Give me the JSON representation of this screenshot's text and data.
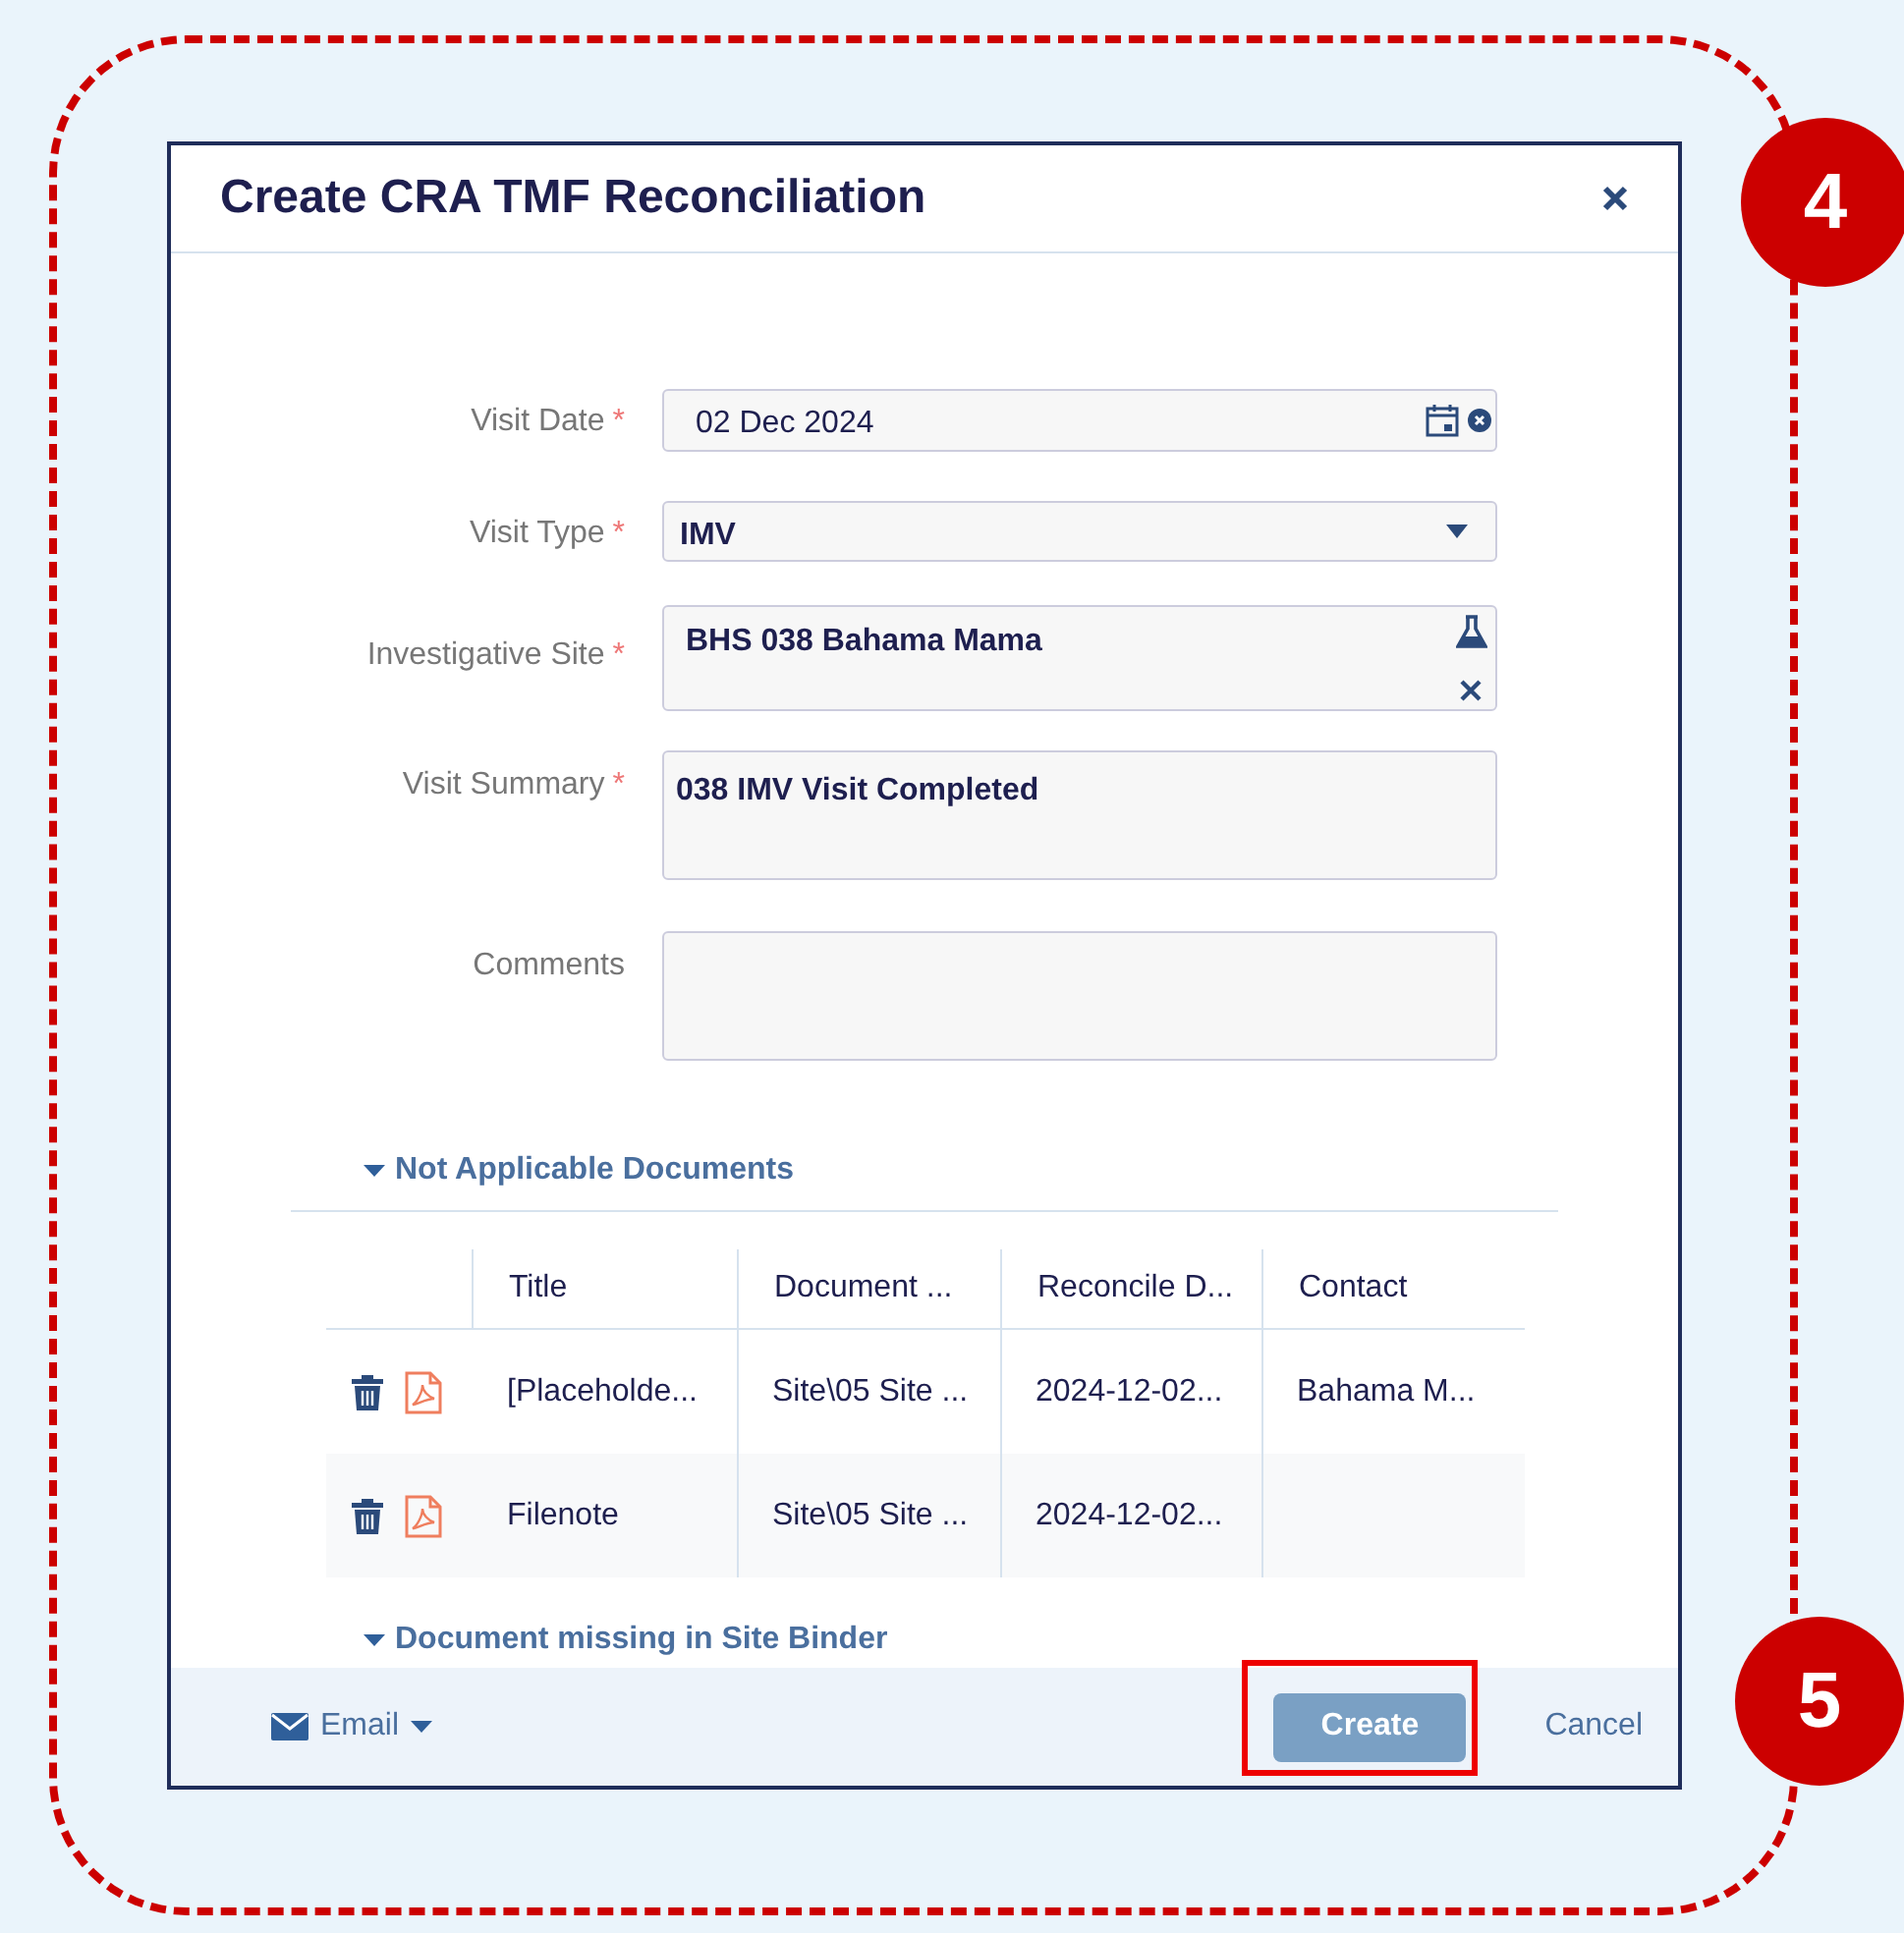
{
  "window": {
    "title": "Create CRA TMF Reconciliation"
  },
  "fields": [
    {
      "kind": "date",
      "label": "Visit Date",
      "required_mark": "*",
      "value": "02 Dec 2024"
    },
    {
      "kind": "select",
      "label": "Visit Type",
      "required_mark": "*",
      "value": "IMV"
    },
    {
      "kind": "lookup",
      "label": "Investigative Site",
      "required_mark": "*",
      "value": "BHS 038 Bahama Mama"
    },
    {
      "kind": "textarea",
      "label": "Visit Summary",
      "required_mark": "*",
      "value": "038 IMV Visit Completed"
    },
    {
      "kind": "textarea",
      "label": "Comments"
    }
  ],
  "sections": [
    {
      "title": "Not Applicable Documents",
      "expanded": true,
      "table": {
        "columns": [
          "Title",
          "Document ...",
          "Reconcile D...",
          "Contact"
        ],
        "rows": [
          {
            "cells": [
              "[Placeholde...",
              "Site\\05 Site ...",
              "2024-12-02...",
              "Bahama M..."
            ]
          },
          {
            "cells": [
              "Filenote",
              "Site\\05 Site ...",
              "2024-12-02...",
              ""
            ]
          }
        ]
      }
    },
    {
      "title": "Document missing in Site Binder",
      "expanded": true
    }
  ],
  "footer": {
    "email": "Email",
    "create": "Create",
    "cancel": "Cancel"
  },
  "annotations": [
    {
      "number": "4"
    },
    {
      "number": "5"
    }
  ]
}
